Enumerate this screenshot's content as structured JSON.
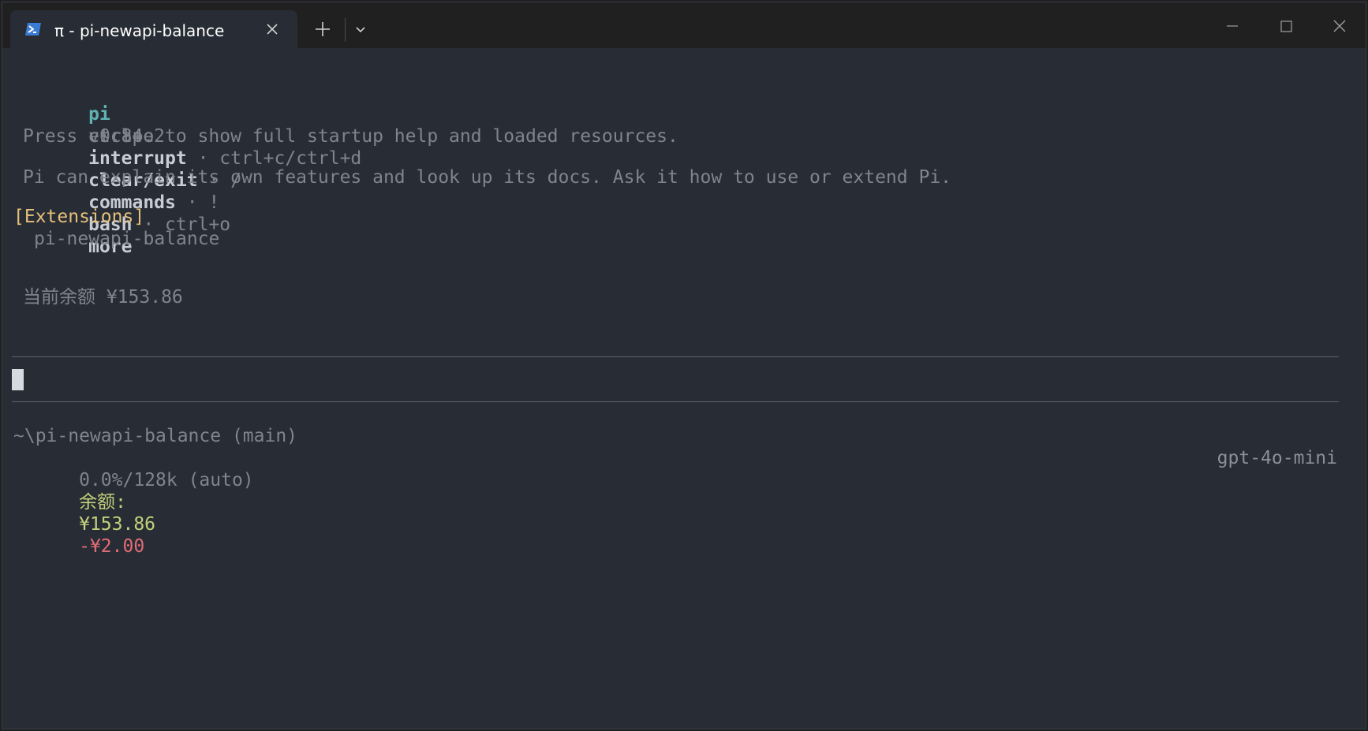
{
  "window": {
    "tab_title": "π - pi-newapi-balance",
    "tab_icon": "powershell-icon"
  },
  "colors": {
    "background": "#282c34",
    "titlebar": "#202020",
    "accent_teal": "#5fb3b3",
    "heading_yellow": "#e5c07b",
    "balance_green": "#c3d17a",
    "cost_red": "#e06c75"
  },
  "header": {
    "app_name": "pi",
    "version": "v0.84.2"
  },
  "shortcuts": [
    {
      "key": "escape",
      "action": "interrupt"
    },
    {
      "key": "ctrl+c/ctrl+d",
      "action": "clear/exit"
    },
    {
      "key": "/",
      "action": "commands"
    },
    {
      "key": "!",
      "action": "bash"
    },
    {
      "key": "ctrl+o",
      "action": "more"
    }
  ],
  "separator": " · ",
  "help_text": "Press ctrl+o to show full startup help and loaded resources.",
  "intro_text": "Pi can explain its own features and look up its docs. Ask it how to use or extend Pi.",
  "extensions": {
    "heading": "[Extensions]",
    "items": [
      "pi-newapi-balance"
    ]
  },
  "balance_message": "当前余额 ¥153.86",
  "footer": {
    "cwd": "~\\pi-newapi-balance (main)",
    "context": "0.0%/128k (auto)",
    "balance_label": "余额:",
    "balance_value": "¥153.86",
    "cost": "-¥2.00",
    "model": "gpt-4o-mini"
  }
}
